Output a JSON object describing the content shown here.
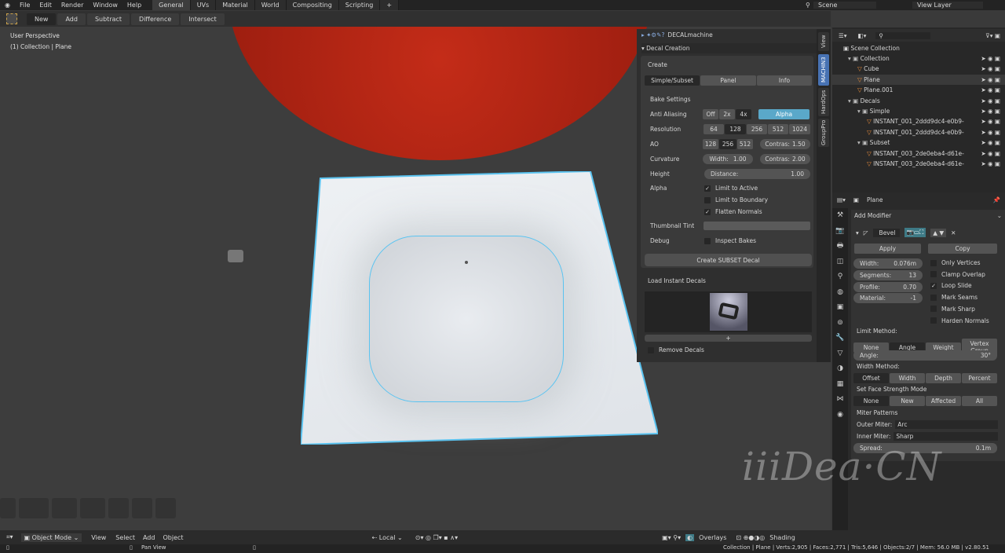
{
  "menu": {
    "items": [
      "File",
      "Edit",
      "Render",
      "Window",
      "Help"
    ],
    "workspaces": [
      "General",
      "UVs",
      "Material",
      "World",
      "Compositing",
      "Scripting",
      "+"
    ],
    "scene": "Scene",
    "view_layer": "View Layer"
  },
  "toolbar": {
    "buttons": [
      "New",
      "Add",
      "Subtract",
      "Difference",
      "Intersect"
    ]
  },
  "viewport": {
    "perspective": "User Perspective",
    "collection": "(1) Collection | Plane"
  },
  "npanel": {
    "addon": "DECALmachine",
    "section": "Decal Creation",
    "create": "Create",
    "tabs": [
      "Simple/Subset",
      "Panel",
      "Info"
    ],
    "bake_settings": "Bake Settings",
    "anti_aliasing": {
      "label": "Anti Aliasing",
      "options": [
        "Off",
        "2x",
        "4x"
      ],
      "alpha": "Alpha"
    },
    "resolution": {
      "label": "Resolution",
      "options": [
        "64",
        "128",
        "256",
        "512",
        "1024"
      ]
    },
    "ao": {
      "label": "AO",
      "options": [
        "128",
        "256",
        "512"
      ],
      "contrast": "Contras:",
      "contrast_value": "1.50"
    },
    "curvature": {
      "label": "Curvature",
      "width": "Width:",
      "width_value": "1.00",
      "contrast": "Contras:",
      "contrast_value": "2.00"
    },
    "height": {
      "label": "Height",
      "distance": "Distance:",
      "distance_value": "1.00"
    },
    "alpha": {
      "label": "Alpha",
      "limit_active": "Limit to Active",
      "limit_boundary": "Limit to Boundary",
      "flatten": "Flatten Normals"
    },
    "thumbnail_tint": "Thumbnail Tint",
    "debug": "Debug",
    "inspect": "Inspect Bakes",
    "create_button": "Create SUBSET Decal",
    "load_instant": "Load Instant Decals",
    "plus": "+",
    "remove": "Remove Decals",
    "side_tabs": [
      "View",
      "MACHIN3",
      "HardOps",
      "GroupPro"
    ]
  },
  "outliner": {
    "scene_collection": "Scene Collection",
    "items": [
      {
        "name": "Collection",
        "depth": 1
      },
      {
        "name": "Cube",
        "depth": 2
      },
      {
        "name": "Plane",
        "depth": 2,
        "selected": true
      },
      {
        "name": "Plane.001",
        "depth": 2
      },
      {
        "name": "Decals",
        "depth": 1
      },
      {
        "name": "Simple",
        "depth": 2
      },
      {
        "name": "INSTANT_001_2ddd9dc4-e0b9-",
        "depth": 3
      },
      {
        "name": "INSTANT_001_2ddd9dc4-e0b9-",
        "depth": 3
      },
      {
        "name": "Subset",
        "depth": 2
      },
      {
        "name": "INSTANT_003_2de0eba4-d61e-",
        "depth": 3
      },
      {
        "name": "INSTANT_003_2de0eba4-d61e-",
        "depth": 3
      }
    ]
  },
  "properties": {
    "object": "Plane",
    "add_modifier": "Add Modifier",
    "modifier_name": "Bevel",
    "apply": "Apply",
    "copy": "Copy",
    "width_label": "Width:",
    "width_value": "0.076m",
    "segments_label": "Segments:",
    "segments_value": "13",
    "profile_label": "Profile:",
    "profile_value": "0.70",
    "material_label": "Material:",
    "material_value": "-1",
    "checks": [
      "Only Vertices",
      "Clamp Overlap",
      "Loop Slide",
      "Mark Seams",
      "Mark Sharp",
      "Harden Normals"
    ],
    "limit_method": "Limit Method:",
    "limit_options": [
      "None",
      "Angle",
      "Weight",
      "Vertex Group"
    ],
    "angle_label": "Angle:",
    "angle_value": "30°",
    "width_method": "Width Method:",
    "width_options": [
      "Offset",
      "Width",
      "Depth",
      "Percent"
    ],
    "face_strength": "Set Face Strength Mode",
    "face_options": [
      "None",
      "New",
      "Affected",
      "All"
    ],
    "miter": "Miter Patterns",
    "outer_label": "Outer Miter:",
    "outer_value": "Arc",
    "inner_label": "Inner Miter:",
    "inner_value": "Sharp",
    "spread_label": "Spread:",
    "spread_value": "0.1m"
  },
  "viewheader": {
    "mode": "Object Mode",
    "menus": [
      "View",
      "Select",
      "Add",
      "Object"
    ],
    "pivot": "Local",
    "overlays": "Overlays",
    "shading": "Shading"
  },
  "status": {
    "action": "Pan View",
    "info": "Collection | Plane | Verts:2,905 | Faces:2,771 | Tris:5,646 | Objects:2/7 | Mem: 56.0 MB | v2.80.51"
  },
  "watermark": "iiiDea·CN",
  "colors": {
    "accent": "#5aa8c9",
    "selection": "#5ac3f0",
    "active_tab": "#4772b3"
  }
}
